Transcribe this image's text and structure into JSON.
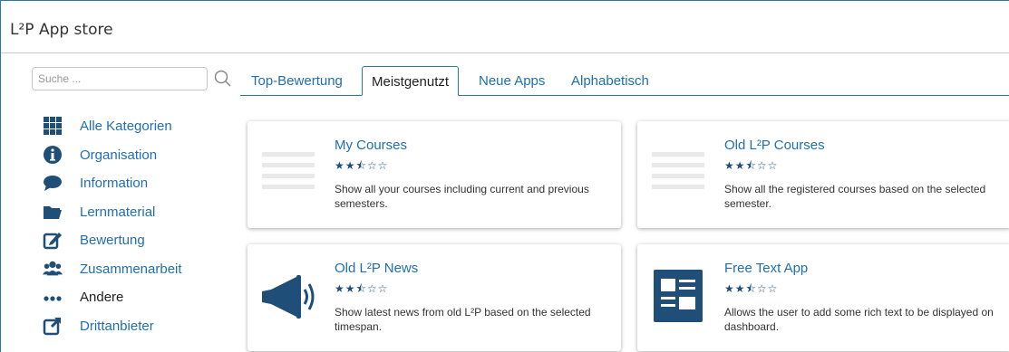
{
  "app": {
    "title": "L²P App store"
  },
  "search": {
    "placeholder": "Suche ..."
  },
  "tabs": [
    {
      "label": "Top-Bewertung",
      "active": false
    },
    {
      "label": "Meistgenutzt",
      "active": true
    },
    {
      "label": "Neue Apps",
      "active": false
    },
    {
      "label": "Alphabetisch",
      "active": false
    }
  ],
  "categories": [
    {
      "label": "Alle Kategorien",
      "icon": "grid-icon"
    },
    {
      "label": "Organisation",
      "icon": "info-circle-icon"
    },
    {
      "label": "Information",
      "icon": "speech-bubble-icon"
    },
    {
      "label": "Lernmaterial",
      "icon": "folder-icon"
    },
    {
      "label": "Bewertung",
      "icon": "edit-icon"
    },
    {
      "label": "Zusammenarbeit",
      "icon": "users-icon"
    },
    {
      "label": "Andere",
      "icon": "dots-icon"
    },
    {
      "label": "Drittanbieter",
      "icon": "external-link-icon"
    }
  ],
  "apps": [
    {
      "name": "My Courses",
      "stars": "★★⯪☆☆",
      "rating": 2.5,
      "description": "Show all your courses including current and previous semesters.",
      "icon": "list-icon"
    },
    {
      "name": "Old L²P Courses",
      "stars": "★★⯪☆☆",
      "rating": 2.5,
      "description": "Show all the registered courses based on the selected semester.",
      "icon": "list-icon"
    },
    {
      "name": "Old L²P News",
      "stars": "★★⯪☆☆",
      "rating": 2.5,
      "description": "Show latest news from old L²P based on the selected timespan.",
      "icon": "megaphone-icon"
    },
    {
      "name": "Free Text App",
      "stars": "★★⯪☆☆",
      "rating": 2.5,
      "description": "Allows the user to add some rich text to be displayed on dashboard.",
      "icon": "text-layout-icon"
    }
  ],
  "colors": {
    "accent": "#1f6fb2",
    "icon_dark": "#1f4e79",
    "border": "#2a7aa8"
  }
}
